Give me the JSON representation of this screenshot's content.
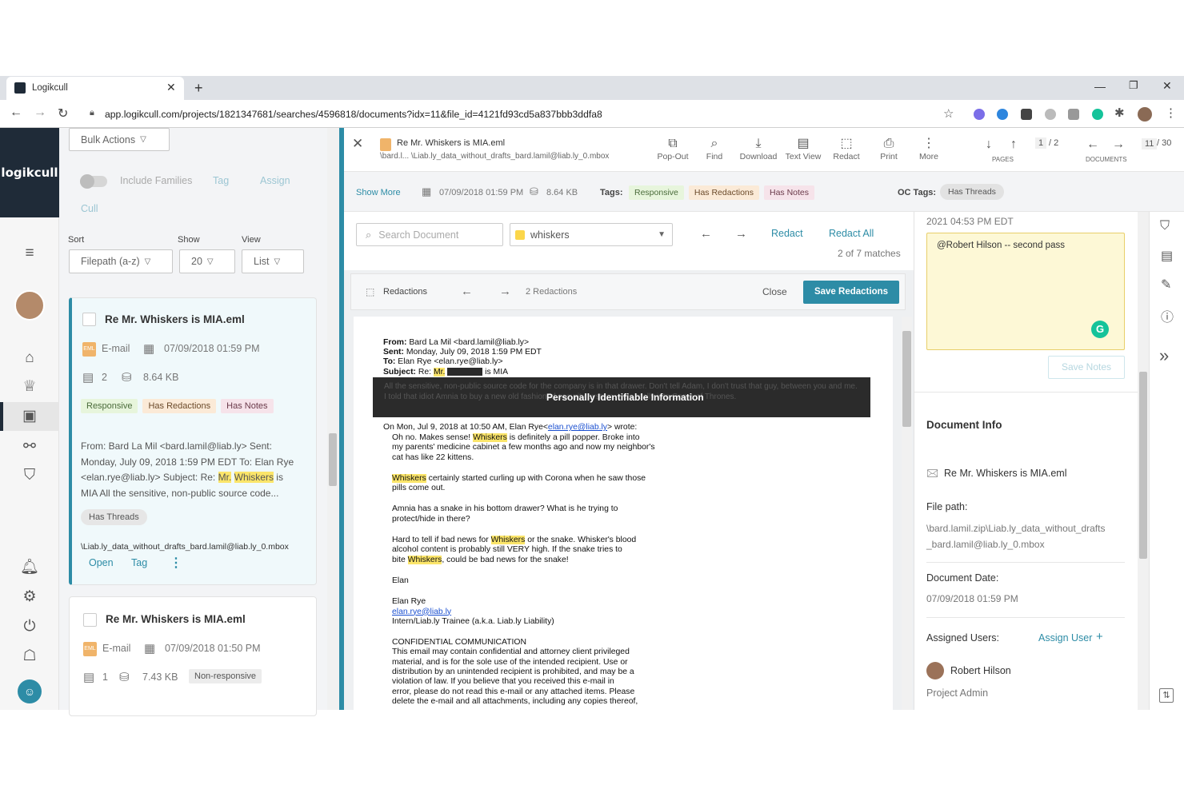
{
  "browser": {
    "tab_title": "Logikcull",
    "url": "app.logikcull.com/projects/1821347681/searches/4596818/documents?idx=11&file_id=4121fd93cd5a837bbb3ddfa8"
  },
  "app": {
    "logo": "logikcull"
  },
  "list": {
    "bulk_actions": "Bulk Actions",
    "include_families": "Include Families",
    "tag": "Tag",
    "assign": "Assign",
    "cull": "Cull",
    "sort_label": "Sort",
    "show_label": "Show",
    "view_label": "View",
    "sort_value": "Filepath (a-z)",
    "show_value": "20",
    "view_value": "List",
    "cards": [
      {
        "title": "Re Mr. Whiskers is MIA.eml",
        "type": "E-mail",
        "date": "07/09/2018 01:59 PM",
        "pages": "2",
        "size": "8.64 KB",
        "tags": [
          "Responsive",
          "Has Redactions",
          "Has Notes"
        ],
        "snippet_1": "From: Bard La Mil <bard.lamil@liab.ly> Sent:",
        "snippet_2": "Monday, July 09, 2018 1:59 PM EDT To: Elan Rye",
        "snippet_3a": "<elan.rye@liab.ly> Subject: Re: ",
        "snippet_hl1": "Mr.",
        "snippet_hl2": "Whiskers",
        "snippet_3b": " is",
        "snippet_4": "MIA All the sensitive, non-public source code...",
        "thread_tag": "Has Threads",
        "path": "\\Liab.ly_data_without_drafts_bard.lamil@liab.ly_0.mbox",
        "open": "Open",
        "tag_action": "Tag"
      },
      {
        "title": "Re Mr. Whiskers is MIA.eml",
        "type": "E-mail",
        "date": "07/09/2018 01:50 PM",
        "pages": "1",
        "size": "7.43 KB",
        "tags": [
          "Non-responsive"
        ]
      }
    ]
  },
  "viewer": {
    "doc_title": "Re Mr. Whiskers is MIA.eml",
    "doc_path": "\\bard.l... \\Liab.ly_data_without_drafts_bard.lamil@liab.ly_0.mbox",
    "toolbar": [
      "Pop-Out",
      "Find",
      "Download",
      "Text View",
      "Redact",
      "Print",
      "More"
    ],
    "pages_current": "1",
    "pages_total": "/ 2",
    "pages_label": "PAGES",
    "docs_label": "DOCUMENTS",
    "docs_current": "11",
    "docs_total": "/ 30",
    "show_more": "Show More",
    "date": "07/09/2018 01:59 PM",
    "size": "8.64 KB",
    "tags_label": "Tags:",
    "tags": [
      "Responsive",
      "Has Redactions",
      "Has Notes"
    ],
    "oc_tags_label": "OC Tags:",
    "oc_tag": "Has Threads",
    "search_placeholder": "Search Document",
    "search_term": "whiskers",
    "redact": "Redact",
    "redact_all": "Redact All",
    "matches": "2 of 7 matches",
    "redactions_label": "Redactions",
    "redactions_count": "2 Redactions",
    "close": "Close",
    "save_redactions": "Save Redactions"
  },
  "email": {
    "from_label": "From:",
    "from_val": " Bard La Mil <bard.lamil@liab.ly>",
    "sent_label": "Sent:",
    "sent_val": " Monday, July 09, 2018 1:59 PM EDT",
    "to_label": "To:",
    "to_val": " Elan Rye <elan.rye@liab.ly>",
    "subject_label": "Subject:",
    "subject_pre": " Re: ",
    "subject_mr": "Mr.",
    "subject_post": " is MIA",
    "redacted_text": "All the sensitive, non-public source code for the company is in that drawer. Don't tell Adam, I don't trust that guy, between you and me. I told that idiot Amnia to buy a new old fashioned security system. He's really into Game of Thrones.",
    "pii_label": "Personally Identifiable Information",
    "on_line_pre": "On Mon, Jul 9, 2018 at 10:50 AM, Elan Rye<",
    "on_line_link": "elan.rye@liab.ly",
    "on_line_post": "> wrote:",
    "p1a": "Oh no. Makes sense! ",
    "p1hl": "Whiskers",
    "p1b": " is definitely a pill popper. Broke into",
    "p1c": "my parents' medicine cabinet a few months ago and now my neighbor's",
    "p1d": "cat has like 22 kittens.",
    "p2hl": "Whiskers",
    "p2a": " certainly started curling up with Corona when he saw those",
    "p2b": "pills come out.",
    "p3a": "Amnia has a snake in his bottom drawer? What is he trying to",
    "p3b": "protect/hide in there?",
    "p4a": "Hard to tell if bad news for ",
    "p4hl": "Whiskers",
    "p4b": " or the snake. Whisker's blood",
    "p4c": "alcohol content is probably still VERY high. If the snake tries to",
    "p4d": "bite ",
    "p4hl2": "Whiskers",
    "p4e": ", could be bad news for the snake!",
    "sig1": "Elan",
    "sig2": "Elan Rye",
    "sig3": "elan.rye@liab.ly",
    "sig4": "Intern/Liab.ly Trainee (a.k.a. Liab.ly Liability)",
    "conf_title": "CONFIDENTIAL COMMUNICATION",
    "conf1": "This email may contain confidential and attorney client privileged",
    "conf2": "material, and is for the sole use of the intended recipient. Use or",
    "conf3": "distribution by an unintended recipient is prohibited, and may be a",
    "conf4": "violation of law. If you believe that you received this e-mail in",
    "conf5": "error, please do not read this e-mail or any attached items. Please",
    "conf6": "delete the e-mail and all attachments, including any copies thereof,"
  },
  "notes": {
    "timestamp": "2021 04:53 PM EDT",
    "note_text": "@Robert Hilson -- second pass",
    "save_notes": "Save Notes"
  },
  "doc_info": {
    "title": "Document Info",
    "file_name": "Re Mr. Whiskers is MIA.eml",
    "file_path_label": "File path:",
    "file_path_1": "\\bard.lamil.zip\\Liab.ly_data_without_drafts",
    "file_path_2": "_bard.lamil@liab.ly_0.mbox",
    "doc_date_label": "Document Date:",
    "doc_date": "07/09/2018 01:59 PM",
    "assigned_label": "Assigned Users:",
    "assign_user": "Assign User",
    "user_name": "Robert Hilson",
    "user_role": "Project Admin"
  },
  "colors": {
    "accent": "#2d8ca6",
    "nav_dark": "#1f2b38",
    "highlight": "#fbe56a",
    "redaction": "#2b2b2b"
  }
}
